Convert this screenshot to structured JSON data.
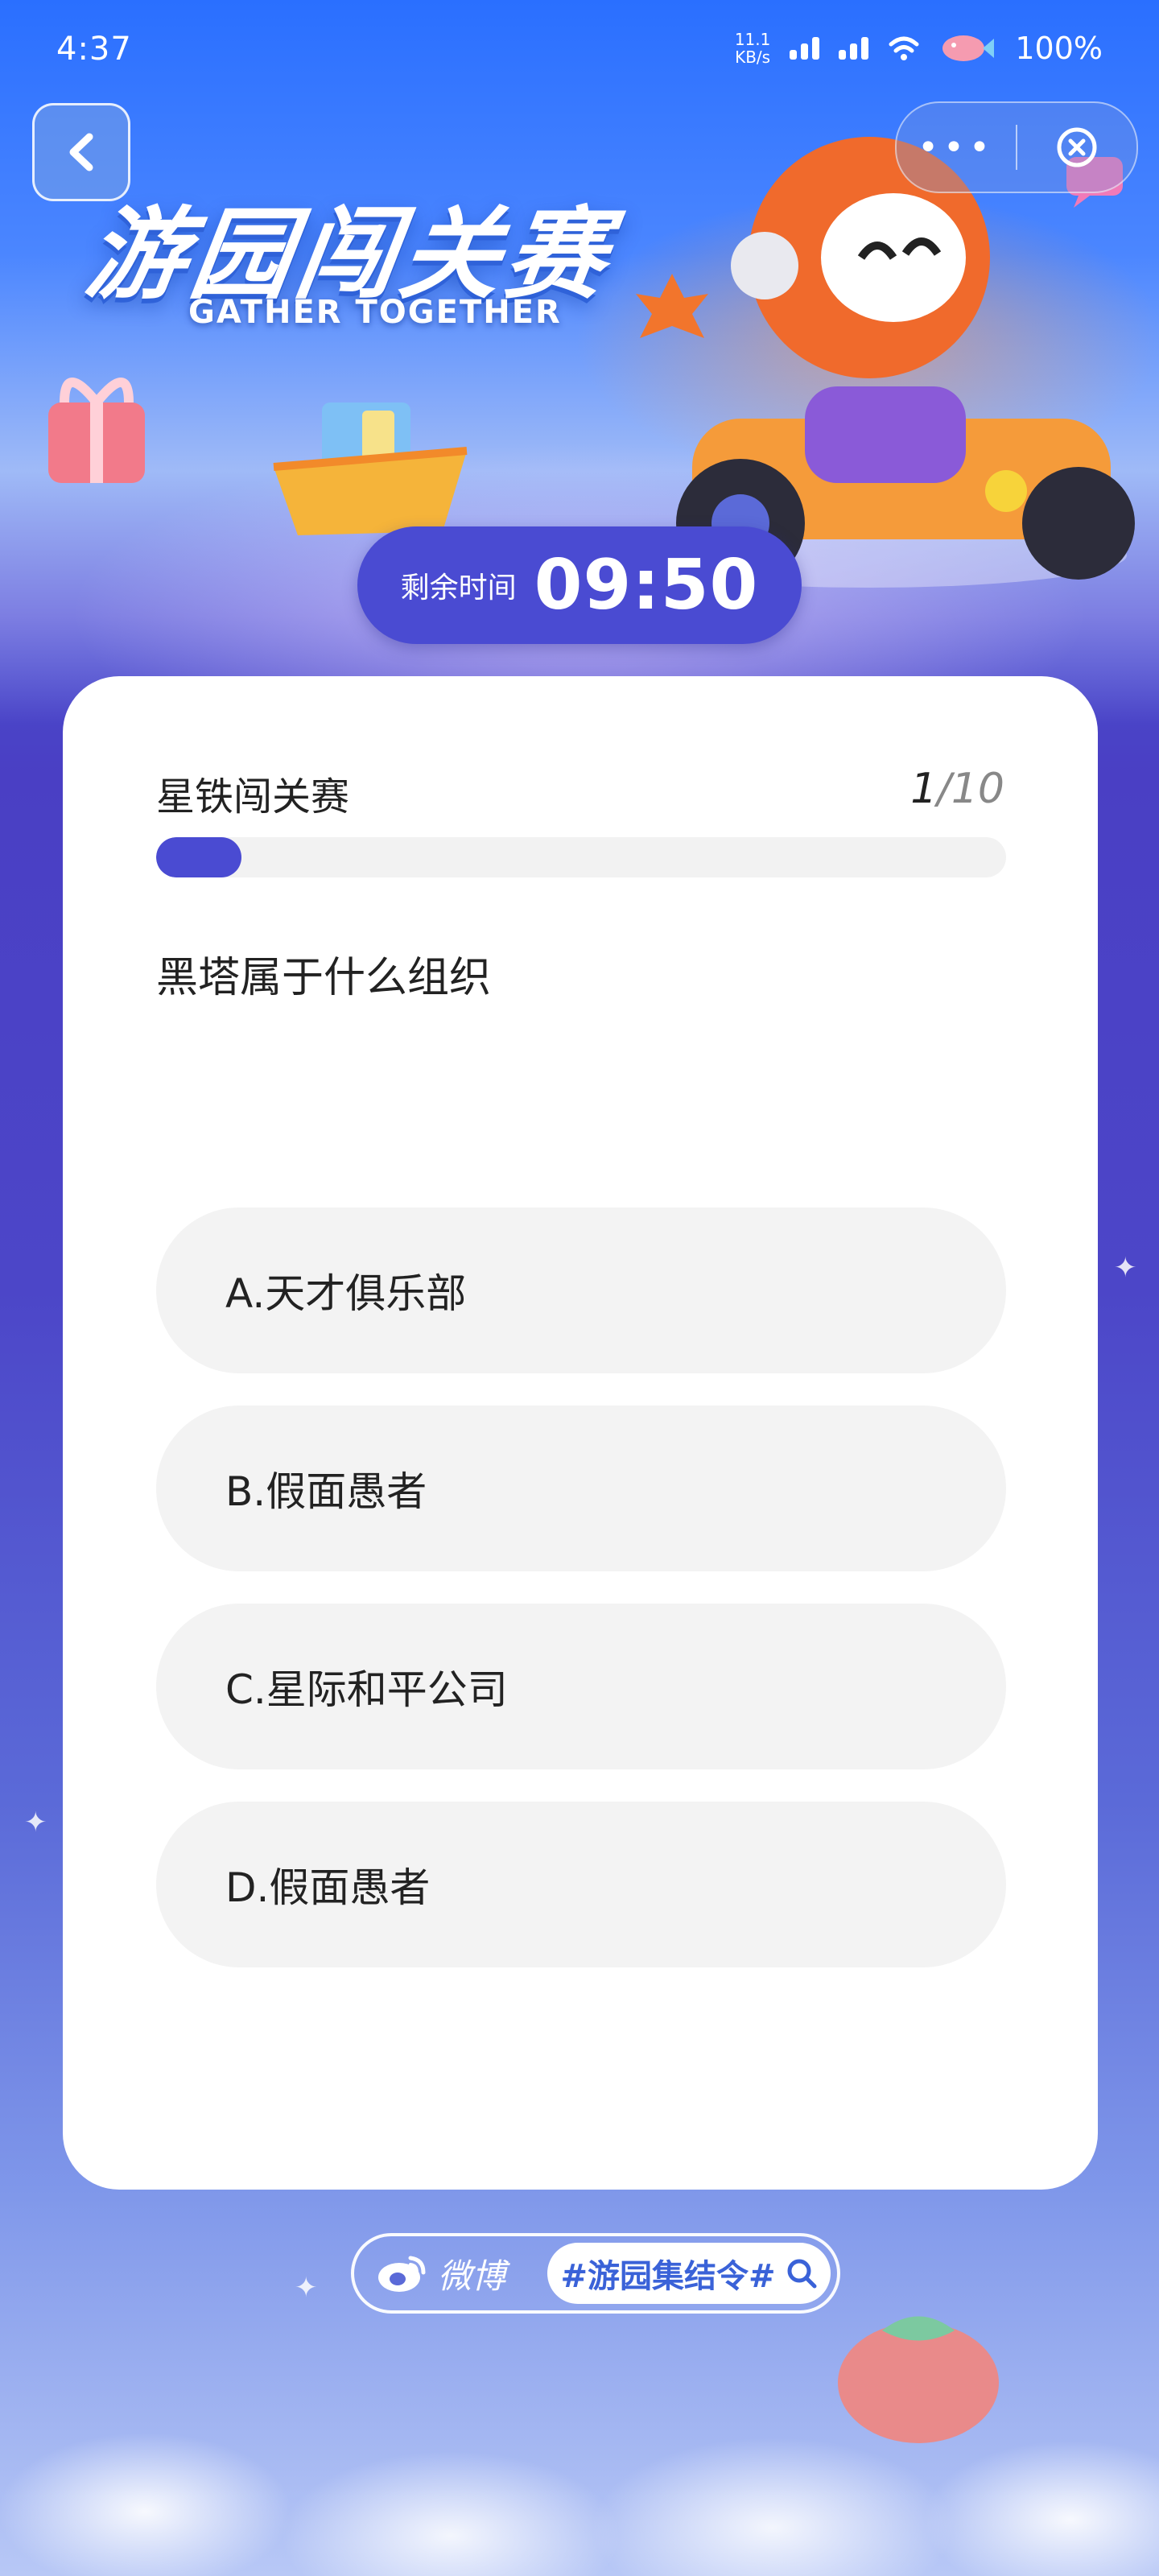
{
  "status_bar": {
    "time": "4:37",
    "net_speed_value": "11.1",
    "net_speed_unit": "KB/s",
    "battery": "100%"
  },
  "banner": {
    "title": "游园闯关赛",
    "subtitle": "GATHER TOGETHER"
  },
  "timer": {
    "label": "剩余时间",
    "value": "09:50"
  },
  "quiz": {
    "title": "星铁闯关赛",
    "progress_current": "1",
    "progress_total": "/10",
    "progress_fraction": 0.1,
    "question": "黑塔属于什么组织",
    "options": [
      "A.天才俱乐部",
      "B.假面愚者",
      "C.星际和平公司",
      "D.假面愚者"
    ]
  },
  "footer": {
    "brand": "微博",
    "hashtag": "#游园集结令#"
  },
  "colors": {
    "accent": "#4a4bd2",
    "option_bg": "#f3f3f3",
    "card_bg": "#ffffff"
  }
}
